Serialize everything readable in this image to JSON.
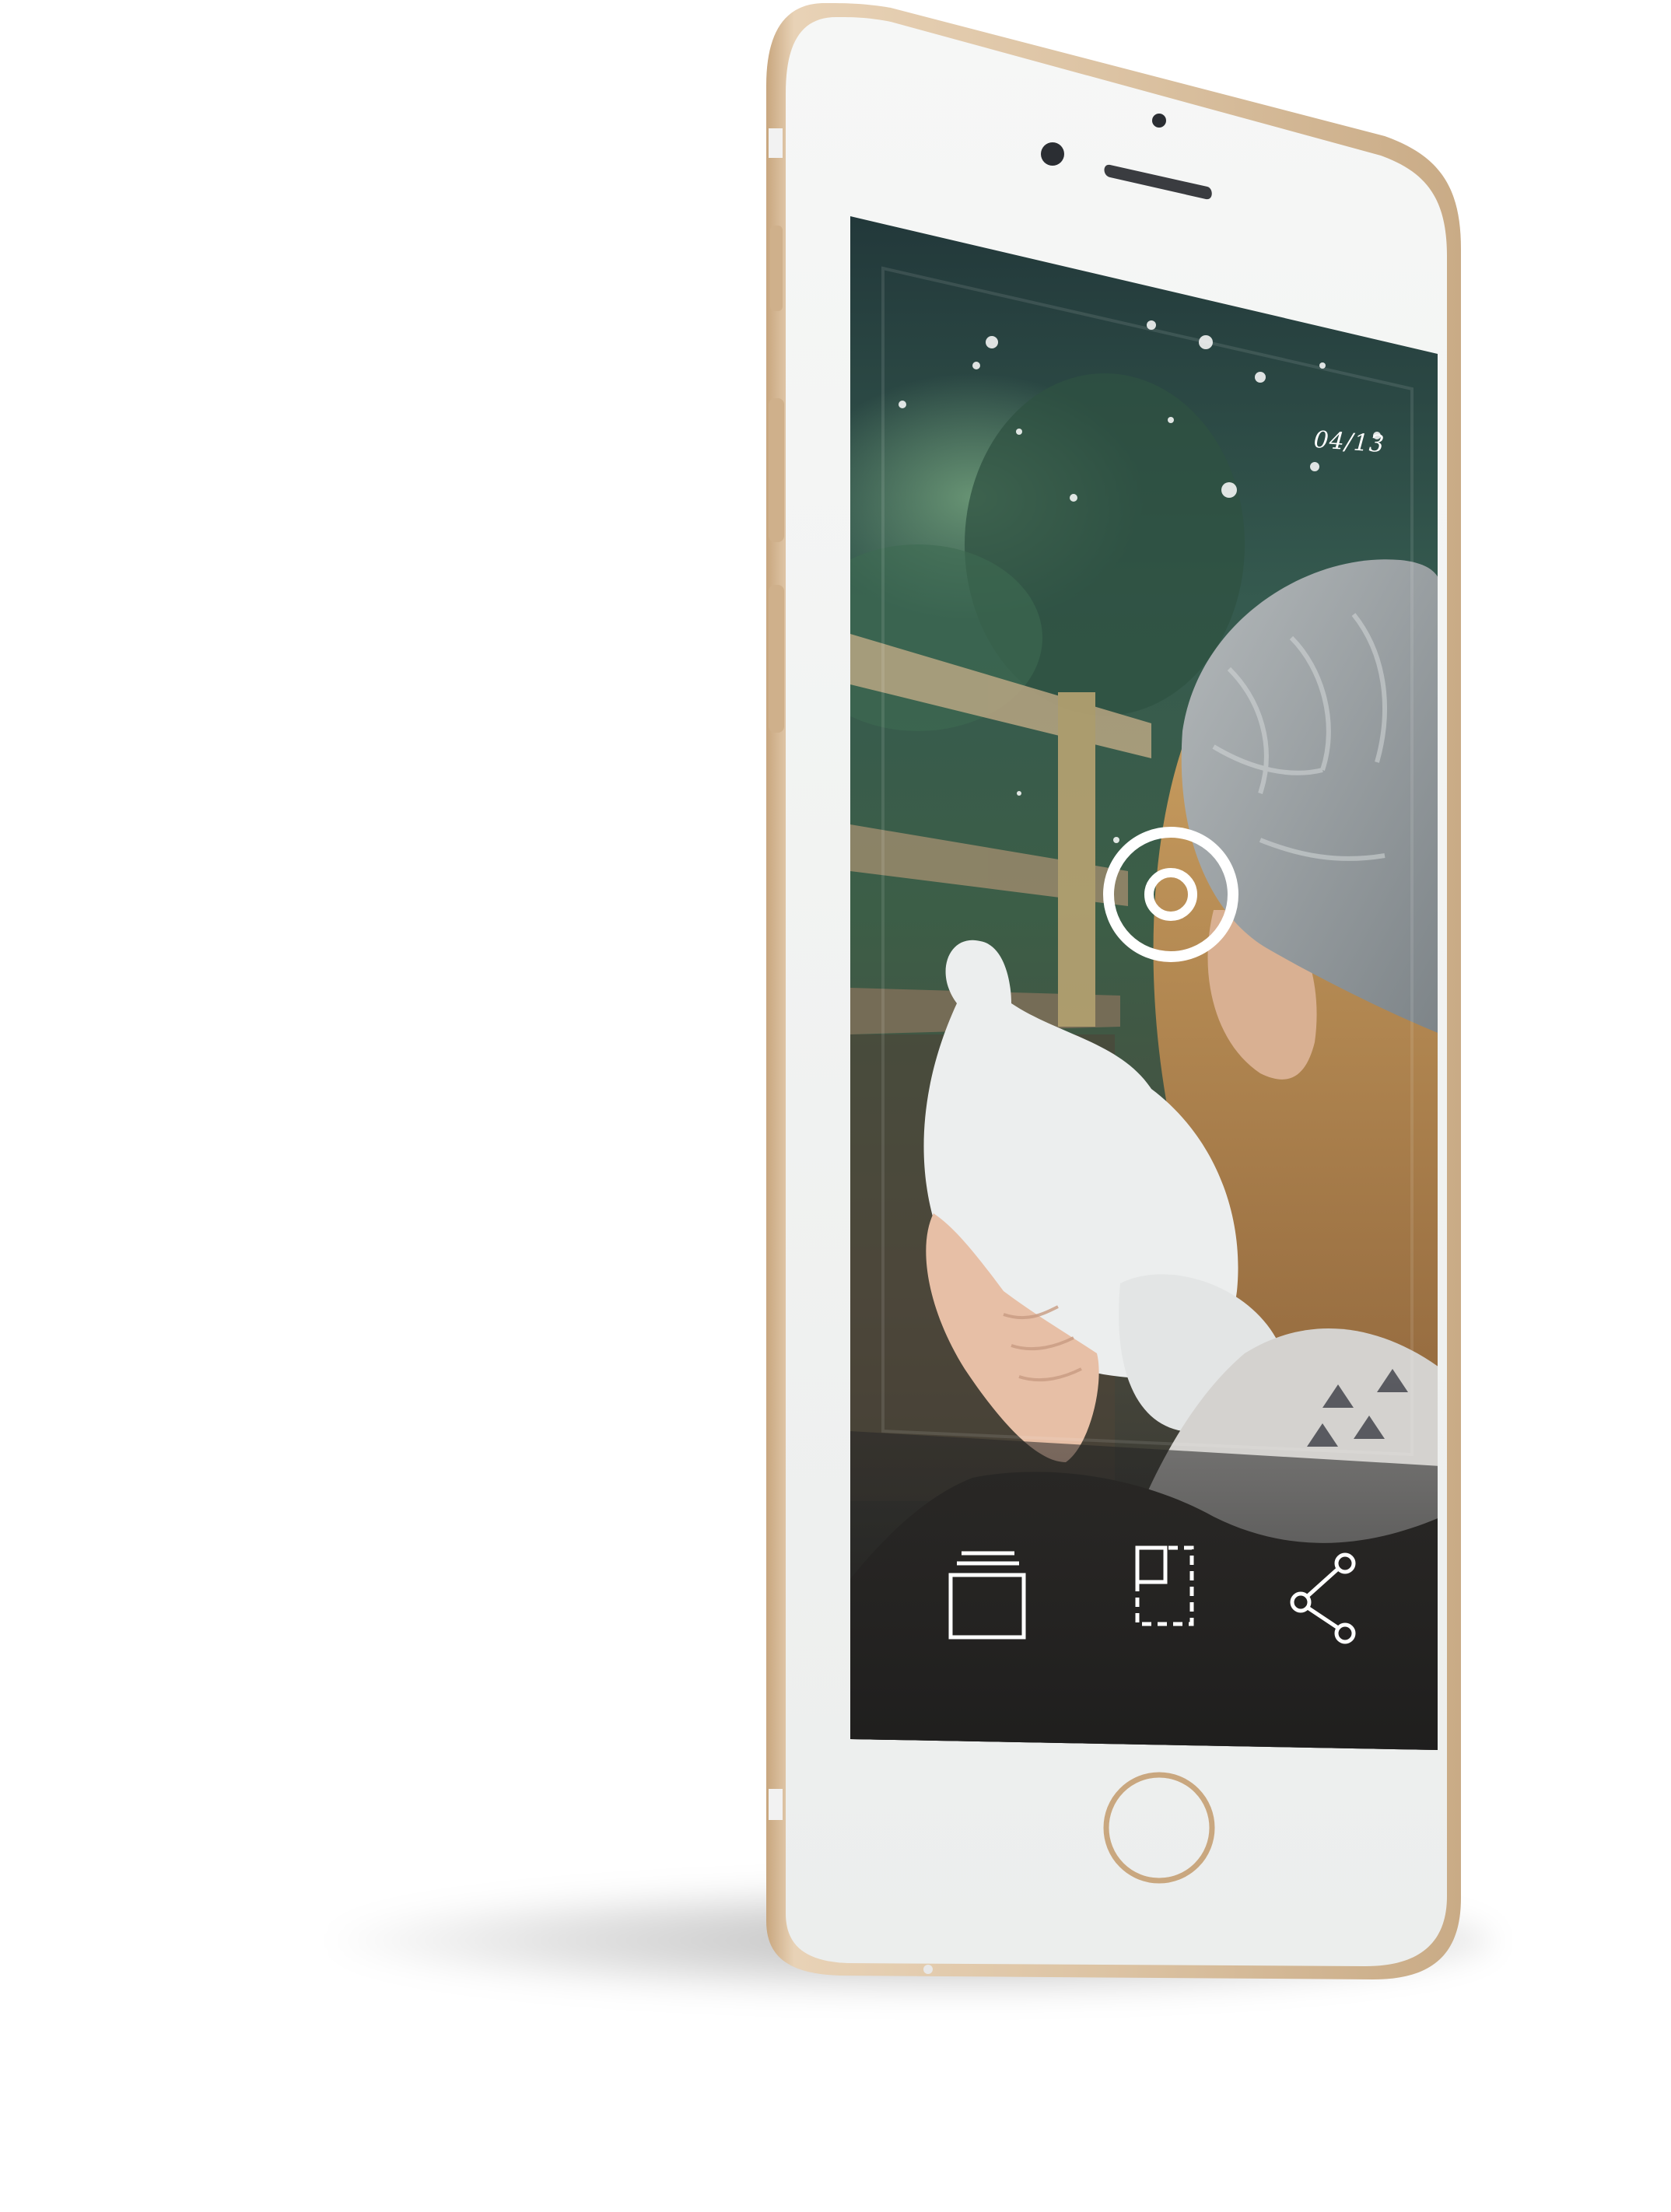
{
  "viewer": {
    "counter": "04/13"
  },
  "toolbar": {
    "actions": [
      {
        "icon": "stack-icon"
      },
      {
        "icon": "crop-icon"
      },
      {
        "icon": "share-icon"
      }
    ]
  },
  "focus_control": {
    "icon": "focus-target-icon"
  },
  "device": {
    "frame_color": "#d8bc9c",
    "bezel_color": "#f2f3f2",
    "home_ring_color": "#c9a77f"
  }
}
